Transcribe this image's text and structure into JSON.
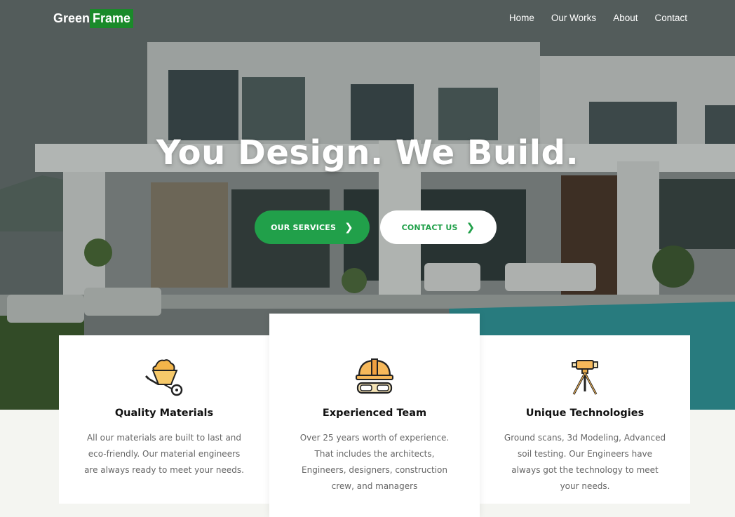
{
  "brand": {
    "part1": "Green",
    "part2": "Frame"
  },
  "nav": {
    "items": [
      "Home",
      "Our Works",
      "About",
      "Contact"
    ]
  },
  "hero": {
    "headline": "You Design. We Build.",
    "services_button": "OUR SERVICES",
    "contact_button": "CONTACT US"
  },
  "features": [
    {
      "title": "Quality Materials",
      "text": "All our materials are built to last and eco-friendly. Our material engineers are always ready to meet your needs.",
      "icon": "wheelbarrow-icon"
    },
    {
      "title": "Experienced Team",
      "text": "Over 25 years worth of experience. That includes the architects, Engineers, designers, construction crew, and managers",
      "icon": "hard-hat-goggles-icon"
    },
    {
      "title": "Unique Technologies",
      "text": "Ground scans, 3d Modeling, Advanced soil testing. Our Engineers have always got the technology to meet your needs.",
      "icon": "surveying-tripod-icon"
    }
  ],
  "colors": {
    "accent": "#21a04a",
    "logo_bg": "#1a8a2a"
  }
}
